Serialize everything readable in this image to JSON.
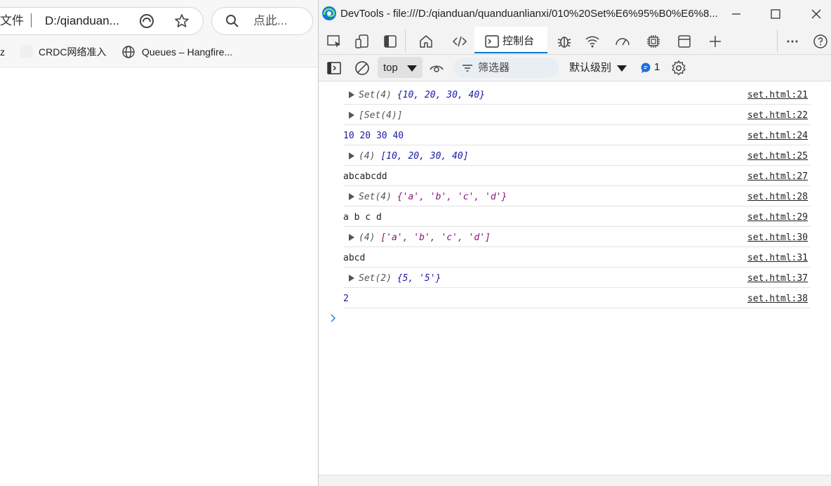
{
  "browser": {
    "address_prefix": "文件",
    "address_url": "D:/qianduan...",
    "search_text": "点此...",
    "bookmarks": {
      "first": "z",
      "crdc": "CRDC网络准入",
      "queues": "Queues – Hangfire..."
    }
  },
  "devtools": {
    "title": "DevTools - file:///D:/qianduan/quanduanlianxi/010%20Set%E6%95%B0%E6%8...",
    "console_tab": "控制台",
    "context": "top",
    "filter_placeholder": "筛选器",
    "level": "默认级别",
    "message_count": "1",
    "accent_color": "#0078d4"
  },
  "console": {
    "rows": [
      {
        "kind": "set",
        "prefix": "Set(4) ",
        "body": "{10, 20, 30, 40}",
        "source": "set.html:21"
      },
      {
        "kind": "arr",
        "prefix": "",
        "body": "[Set(4)]",
        "source": "set.html:22"
      },
      {
        "kind": "plain-num",
        "prefix": "",
        "body": "10 20 30 40",
        "source": "set.html:24"
      },
      {
        "kind": "arr-num",
        "prefix": "(4) ",
        "body": "[10, 20, 30, 40]",
        "source": "set.html:25"
      },
      {
        "kind": "plain",
        "prefix": "",
        "body": "abcabcdd",
        "source": "set.html:27"
      },
      {
        "kind": "set-str",
        "prefix": "Set(4) ",
        "body": "{'a', 'b', 'c', 'd'}",
        "source": "set.html:28"
      },
      {
        "kind": "plain",
        "prefix": "",
        "body": "a b c d",
        "source": "set.html:29"
      },
      {
        "kind": "arr-str",
        "prefix": "(4) ",
        "body": "['a', 'b', 'c', 'd']",
        "source": "set.html:30"
      },
      {
        "kind": "plain",
        "prefix": "",
        "body": "abcd",
        "source": "set.html:31"
      },
      {
        "kind": "set-mixed",
        "prefix": "Set(2) ",
        "body": "{5, '5'}",
        "source": "set.html:37"
      },
      {
        "kind": "plain-num",
        "prefix": "",
        "body": "2",
        "source": "set.html:38"
      }
    ]
  }
}
